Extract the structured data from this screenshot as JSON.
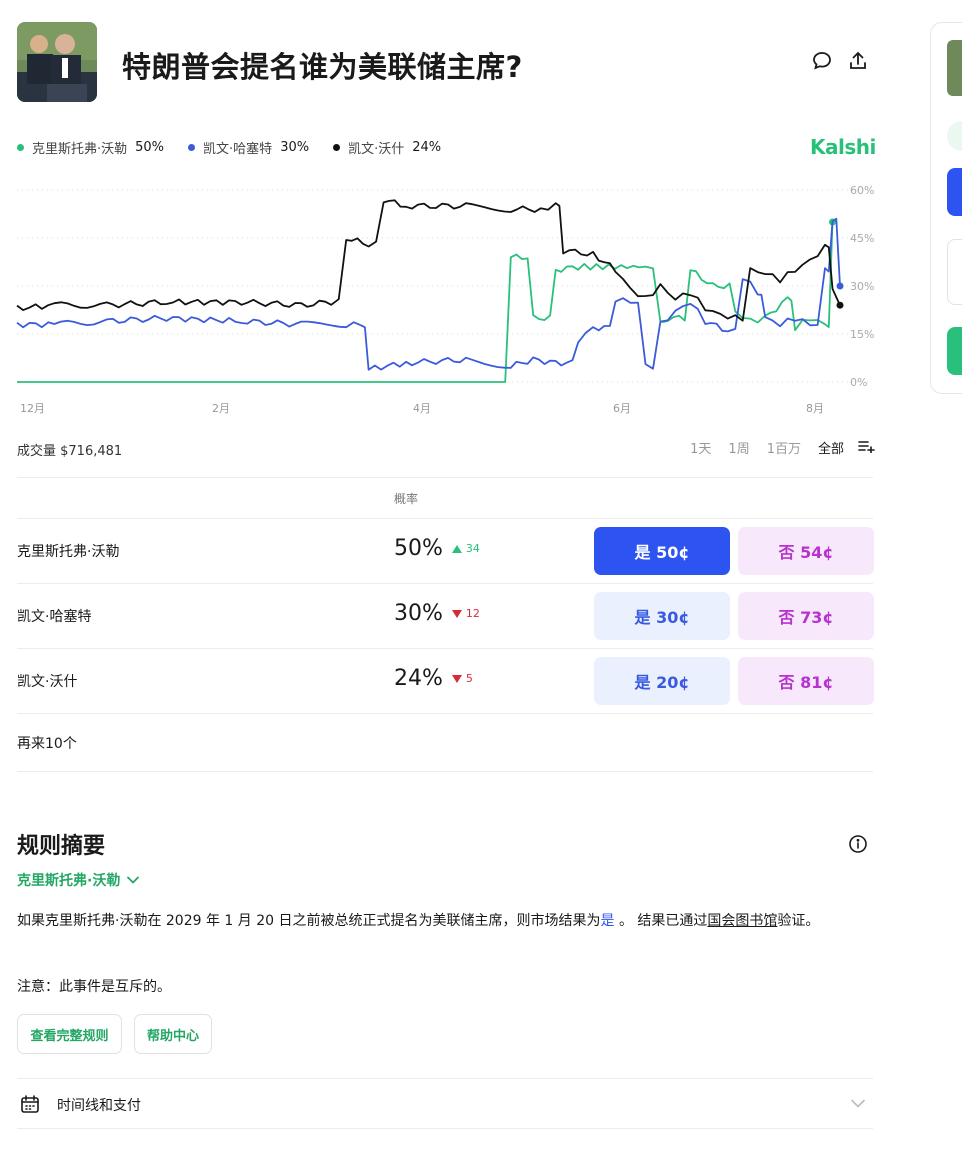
{
  "market": {
    "title": "特朗普会提名谁为美联储主席?",
    "brand": "Kalshi"
  },
  "legend": [
    {
      "name": "克里斯托弗·沃勒",
      "pct": "50%",
      "color": "#28c07a"
    },
    {
      "name": "凯文·哈塞特",
      "pct": "30%",
      "color": "#3b5bdb"
    },
    {
      "name": "凯文·沃什",
      "pct": "24%",
      "color": "#111111"
    }
  ],
  "chart_data": {
    "type": "line",
    "x_ticks": [
      "12月",
      "2月",
      "4月",
      "6月",
      "8月"
    ],
    "y_ticks": [
      "60%",
      "45%",
      "30%",
      "15%",
      "0%"
    ],
    "ylim": [
      0,
      60
    ],
    "grid": true,
    "series": [
      {
        "name": "克里斯托弗·沃勒",
        "color": "#28c07a",
        "end_label": "50%",
        "points": [
          [
            0,
            0
          ],
          [
            0.63,
            0
          ],
          [
            0.66,
            39
          ],
          [
            0.69,
            20
          ],
          [
            0.72,
            35
          ],
          [
            0.75,
            36
          ],
          [
            0.84,
            36
          ],
          [
            0.86,
            18
          ],
          [
            0.87,
            20
          ],
          [
            0.9,
            35
          ],
          [
            0.93,
            30
          ],
          [
            0.96,
            22
          ],
          [
            0.98,
            19
          ],
          [
            1.0,
            20
          ],
          [
            1.03,
            26
          ],
          [
            1.04,
            17
          ],
          [
            1.06,
            20
          ],
          [
            1.08,
            18
          ],
          [
            1.09,
            50
          ]
        ]
      },
      {
        "name": "凯文·哈塞特",
        "color": "#3b5bdb",
        "end_label": "30%",
        "points": [
          [
            0,
            18
          ],
          [
            0.05,
            18
          ],
          [
            0.12,
            19
          ],
          [
            0.2,
            20
          ],
          [
            0.3,
            19
          ],
          [
            0.38,
            18
          ],
          [
            0.44,
            18
          ],
          [
            0.46,
            18
          ],
          [
            0.47,
            4
          ],
          [
            0.52,
            6
          ],
          [
            0.6,
            7
          ],
          [
            0.66,
            5
          ],
          [
            0.69,
            7
          ],
          [
            0.72,
            6
          ],
          [
            0.75,
            13
          ],
          [
            0.77,
            17
          ],
          [
            0.8,
            26
          ],
          [
            0.82,
            25
          ],
          [
            0.84,
            5
          ],
          [
            0.86,
            18
          ],
          [
            0.88,
            22
          ],
          [
            0.9,
            25
          ],
          [
            0.92,
            19
          ],
          [
            0.95,
            16
          ],
          [
            0.97,
            33
          ],
          [
            0.99,
            28
          ],
          [
            1.0,
            20
          ],
          [
            1.02,
            18
          ],
          [
            1.04,
            20
          ],
          [
            1.06,
            18
          ],
          [
            1.08,
            35
          ],
          [
            1.09,
            51
          ],
          [
            1.1,
            30
          ]
        ]
      },
      {
        "name": "凯文·沃什",
        "color": "#111111",
        "end_label": "24%",
        "points": [
          [
            0,
            23
          ],
          [
            0.05,
            24
          ],
          [
            0.12,
            24
          ],
          [
            0.2,
            25
          ],
          [
            0.3,
            25
          ],
          [
            0.38,
            24
          ],
          [
            0.42,
            25
          ],
          [
            0.44,
            45
          ],
          [
            0.47,
            43
          ],
          [
            0.49,
            57
          ],
          [
            0.52,
            55
          ],
          [
            0.6,
            55
          ],
          [
            0.66,
            54
          ],
          [
            0.7,
            54
          ],
          [
            0.72,
            55
          ],
          [
            0.73,
            41
          ],
          [
            0.77,
            40
          ],
          [
            0.8,
            35
          ],
          [
            0.82,
            29
          ],
          [
            0.84,
            26
          ],
          [
            0.86,
            30
          ],
          [
            0.88,
            26
          ],
          [
            0.9,
            28
          ],
          [
            0.92,
            23
          ],
          [
            0.94,
            21
          ],
          [
            0.96,
            20
          ],
          [
            0.98,
            35
          ],
          [
            1.0,
            34
          ],
          [
            1.02,
            32
          ],
          [
            1.04,
            35
          ],
          [
            1.06,
            38
          ],
          [
            1.08,
            42
          ],
          [
            1.09,
            30
          ],
          [
            1.1,
            24
          ]
        ]
      }
    ],
    "x_span": [
      0,
      1.1
    ]
  },
  "volume": "成交量 $716,481",
  "ranges": [
    "1天",
    "1周",
    "1百万",
    "全部"
  ],
  "table": {
    "prob_header": "概率",
    "rows": [
      {
        "name": "克里斯托弗·沃勒",
        "pct": "50%",
        "delta": "34",
        "dir": "up",
        "yes": "是 50¢",
        "no": "否 54¢",
        "primary": true
      },
      {
        "name": "凯文·哈塞特",
        "pct": "30%",
        "delta": "12",
        "dir": "down",
        "yes": "是 30¢",
        "no": "否 73¢",
        "primary": false
      },
      {
        "name": "凯文·沃什",
        "pct": "24%",
        "delta": "5",
        "dir": "down",
        "yes": "是 20¢",
        "no": "否 81¢",
        "primary": false
      }
    ],
    "more": "再来10个"
  },
  "rules": {
    "title": "规则摘要",
    "outcome": "克里斯托弗·沃勒",
    "text_before": "如果克里斯托弗·沃勒在 2029 年 1 月 20 日之前被总统正式提名为美联储主席，则市场结果为",
    "yes_word": "是",
    "text_middle": " 。 结果已通过",
    "link": "国会图书馆",
    "text_after": "验证。",
    "note": "注意：此事件是互斥的。",
    "full_rules": "查看完整规则",
    "help": "帮助中心"
  },
  "timeline": {
    "label": "时间线和支付"
  }
}
